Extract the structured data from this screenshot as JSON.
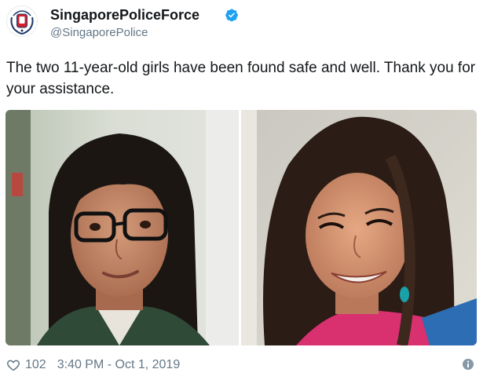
{
  "user": {
    "display_name": "SingaporePoliceForce",
    "handle": "@SingaporePolice",
    "verified": true,
    "avatar_icon": "police-crest-icon"
  },
  "tweet": {
    "text": "The two 11-year-old girls have been found safe and well. Thank you for your assistance.",
    "media": [
      {
        "kind": "photo",
        "subject": "girl with glasses"
      },
      {
        "kind": "photo",
        "subject": "girl with braided hair"
      }
    ]
  },
  "footer": {
    "like_count": "102",
    "timestamp": "3:40 PM - Oct 1, 2019",
    "like_icon": "heart-icon",
    "info_icon": "info-icon"
  },
  "colors": {
    "text_primary": "#14171a",
    "text_secondary": "#657786",
    "verified_blue": "#1da1f2",
    "crest_red": "#d0202a"
  }
}
